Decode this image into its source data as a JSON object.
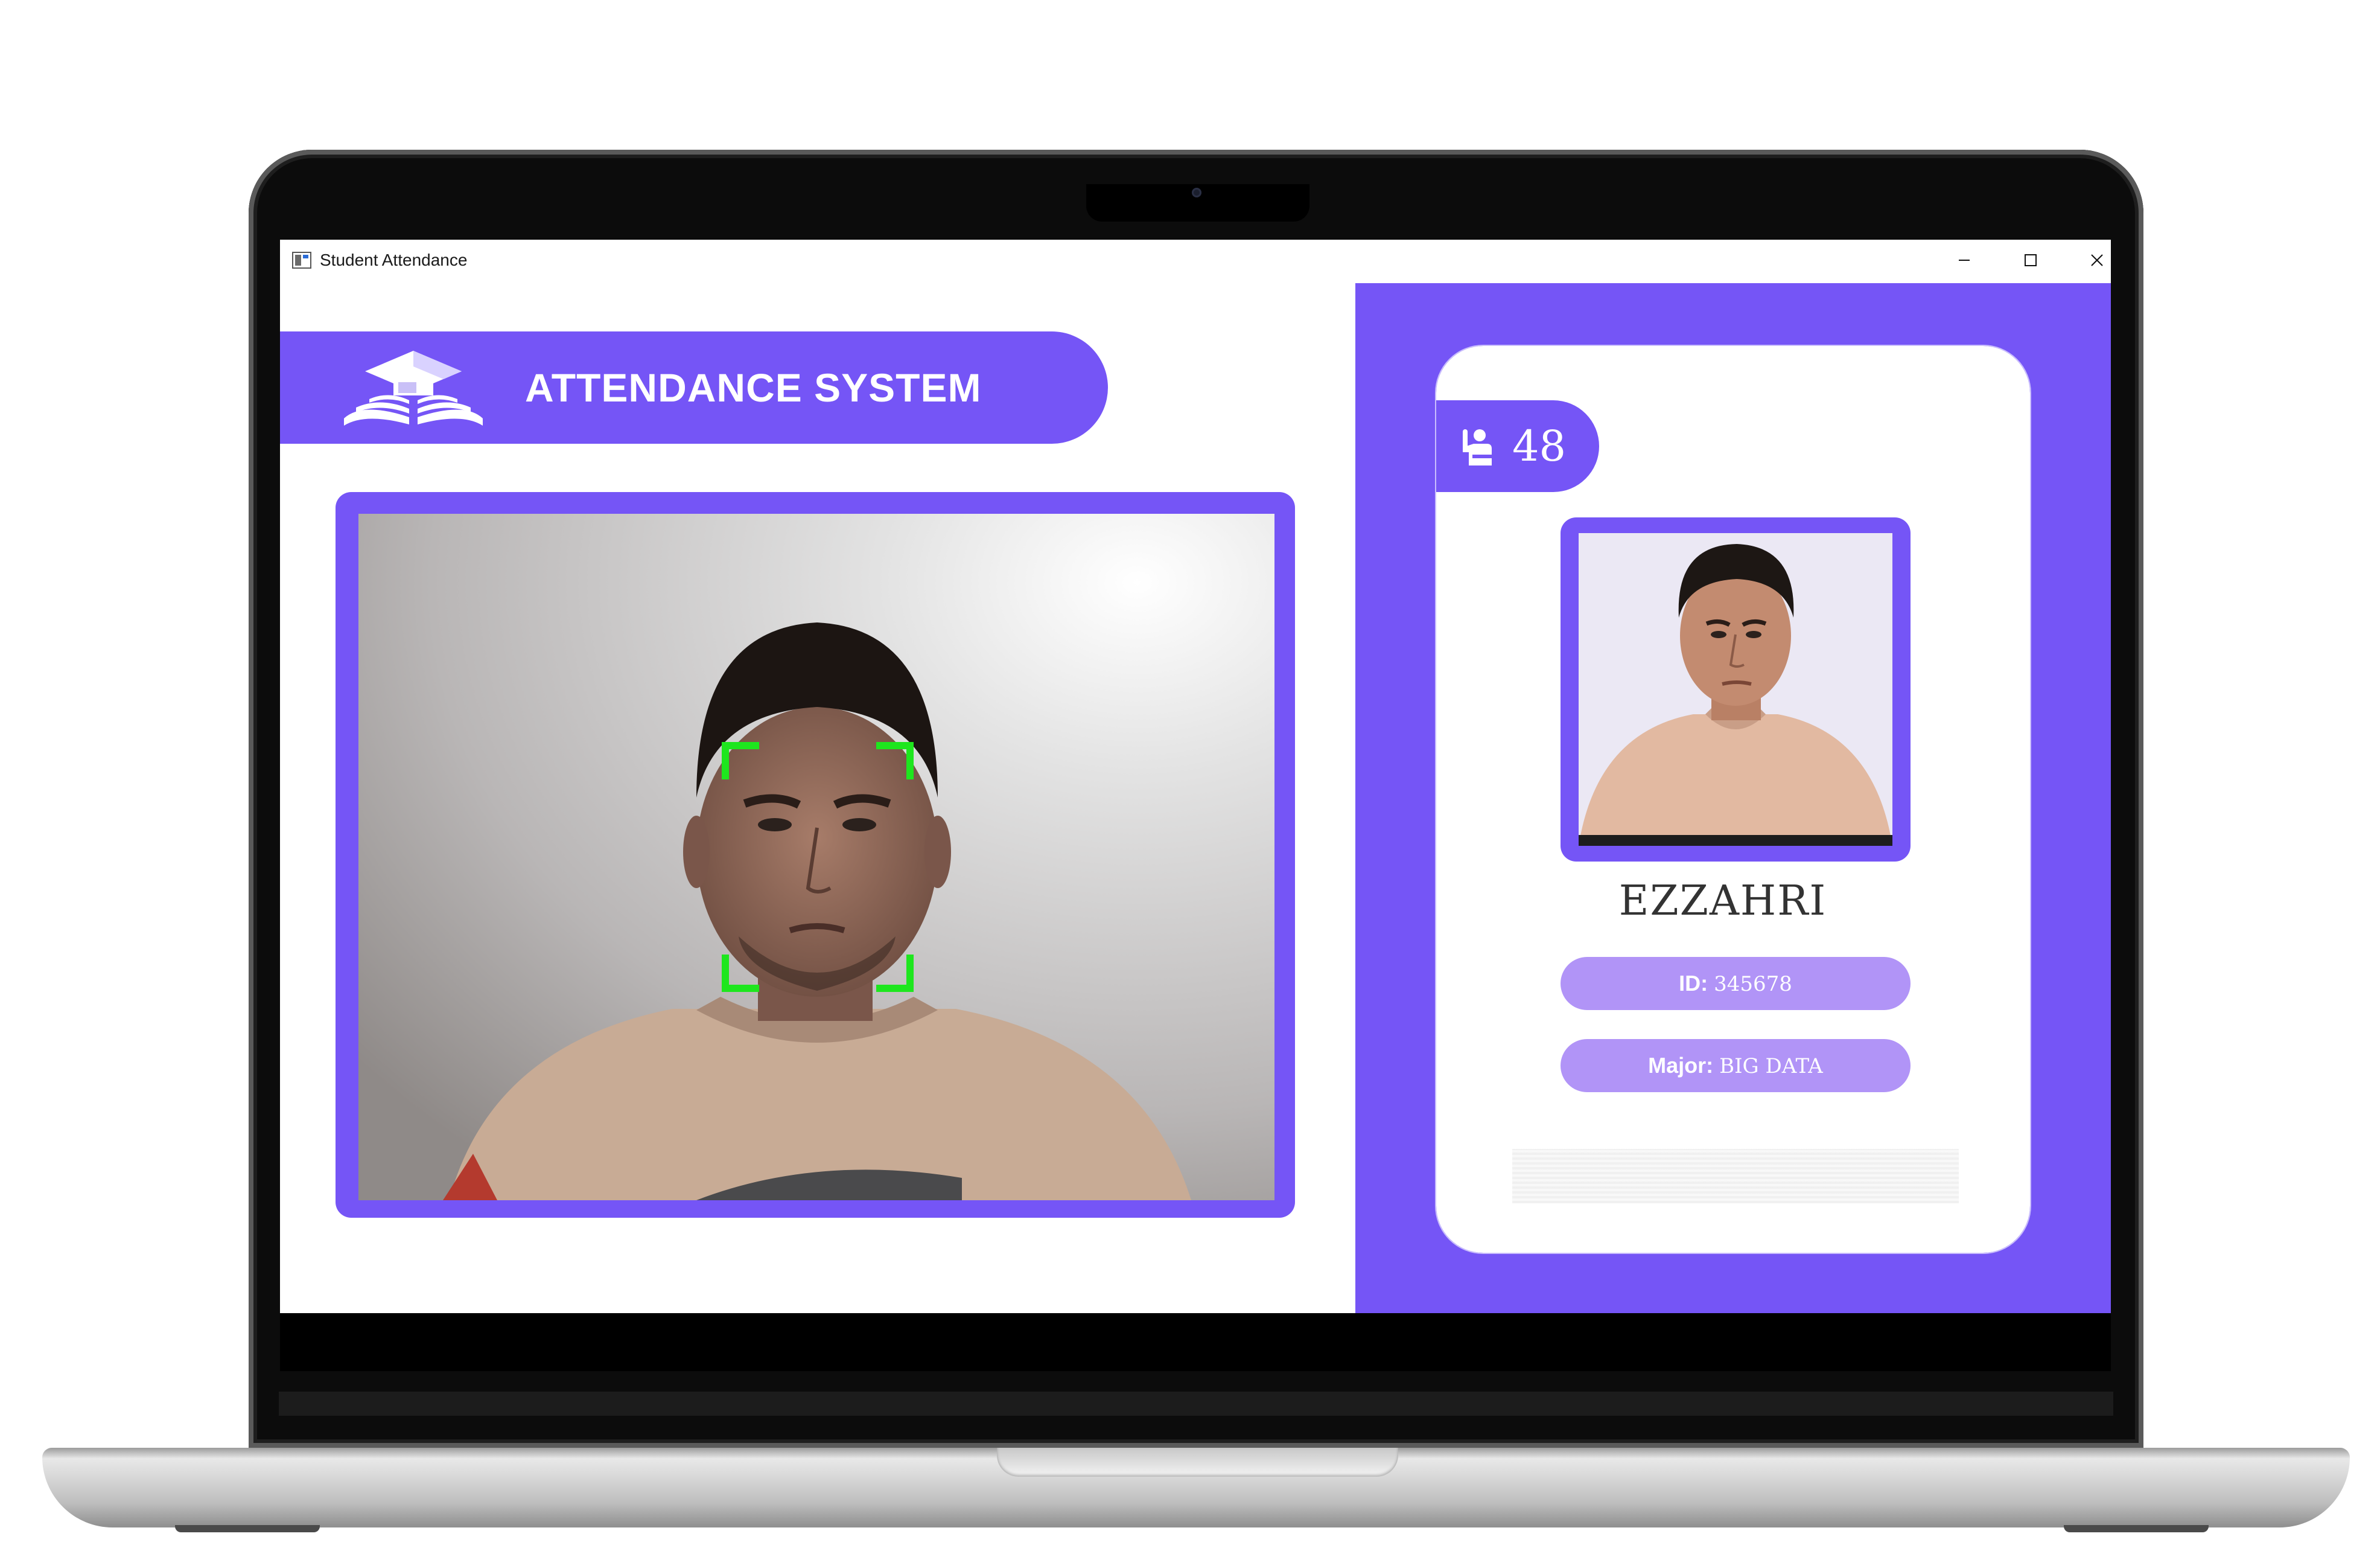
{
  "window": {
    "title": "Student Attendance",
    "controls": [
      "minimize",
      "maximize",
      "close"
    ]
  },
  "header": {
    "brand_title": "ATTENDANCE SYSTEM",
    "logo_icon": "graduation-book-icon"
  },
  "camera": {
    "icon": "face-detection-brackets",
    "bracket_color": "#1ee61e"
  },
  "student_card": {
    "count_icon": "student-raising-hand-icon",
    "count": "48",
    "name": "EZZAHRI",
    "id_label": "ID:",
    "id_value": "345678",
    "major_label": "Major:",
    "major_value": "BIG DATA"
  },
  "colors": {
    "accent": "#7555f6",
    "pill": "#b194f7",
    "detection": "#1ee61e"
  }
}
